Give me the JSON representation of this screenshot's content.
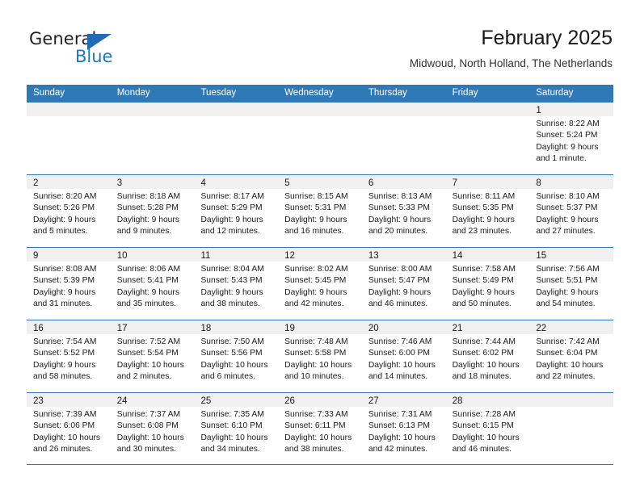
{
  "brand": {
    "name_part1": "General",
    "name_part2": "Blue",
    "logo_icon": "triangle-logo-icon",
    "accent_color": "#1f78c1"
  },
  "header": {
    "title": "February 2025",
    "subtitle": "Midwoud, North Holland, The Netherlands"
  },
  "calendar": {
    "header_color": "#3079b8",
    "weekdays": [
      "Sunday",
      "Monday",
      "Tuesday",
      "Wednesday",
      "Thursday",
      "Friday",
      "Saturday"
    ],
    "weeks": [
      [
        {
          "day": "",
          "sunrise": "",
          "sunset": "",
          "daylight1": "",
          "daylight2": ""
        },
        {
          "day": "",
          "sunrise": "",
          "sunset": "",
          "daylight1": "",
          "daylight2": ""
        },
        {
          "day": "",
          "sunrise": "",
          "sunset": "",
          "daylight1": "",
          "daylight2": ""
        },
        {
          "day": "",
          "sunrise": "",
          "sunset": "",
          "daylight1": "",
          "daylight2": ""
        },
        {
          "day": "",
          "sunrise": "",
          "sunset": "",
          "daylight1": "",
          "daylight2": ""
        },
        {
          "day": "",
          "sunrise": "",
          "sunset": "",
          "daylight1": "",
          "daylight2": ""
        },
        {
          "day": "1",
          "sunrise": "Sunrise: 8:22 AM",
          "sunset": "Sunset: 5:24 PM",
          "daylight1": "Daylight: 9 hours",
          "daylight2": "and 1 minute."
        }
      ],
      [
        {
          "day": "2",
          "sunrise": "Sunrise: 8:20 AM",
          "sunset": "Sunset: 5:26 PM",
          "daylight1": "Daylight: 9 hours",
          "daylight2": "and 5 minutes."
        },
        {
          "day": "3",
          "sunrise": "Sunrise: 8:18 AM",
          "sunset": "Sunset: 5:28 PM",
          "daylight1": "Daylight: 9 hours",
          "daylight2": "and 9 minutes."
        },
        {
          "day": "4",
          "sunrise": "Sunrise: 8:17 AM",
          "sunset": "Sunset: 5:29 PM",
          "daylight1": "Daylight: 9 hours",
          "daylight2": "and 12 minutes."
        },
        {
          "day": "5",
          "sunrise": "Sunrise: 8:15 AM",
          "sunset": "Sunset: 5:31 PM",
          "daylight1": "Daylight: 9 hours",
          "daylight2": "and 16 minutes."
        },
        {
          "day": "6",
          "sunrise": "Sunrise: 8:13 AM",
          "sunset": "Sunset: 5:33 PM",
          "daylight1": "Daylight: 9 hours",
          "daylight2": "and 20 minutes."
        },
        {
          "day": "7",
          "sunrise": "Sunrise: 8:11 AM",
          "sunset": "Sunset: 5:35 PM",
          "daylight1": "Daylight: 9 hours",
          "daylight2": "and 23 minutes."
        },
        {
          "day": "8",
          "sunrise": "Sunrise: 8:10 AM",
          "sunset": "Sunset: 5:37 PM",
          "daylight1": "Daylight: 9 hours",
          "daylight2": "and 27 minutes."
        }
      ],
      [
        {
          "day": "9",
          "sunrise": "Sunrise: 8:08 AM",
          "sunset": "Sunset: 5:39 PM",
          "daylight1": "Daylight: 9 hours",
          "daylight2": "and 31 minutes."
        },
        {
          "day": "10",
          "sunrise": "Sunrise: 8:06 AM",
          "sunset": "Sunset: 5:41 PM",
          "daylight1": "Daylight: 9 hours",
          "daylight2": "and 35 minutes."
        },
        {
          "day": "11",
          "sunrise": "Sunrise: 8:04 AM",
          "sunset": "Sunset: 5:43 PM",
          "daylight1": "Daylight: 9 hours",
          "daylight2": "and 38 minutes."
        },
        {
          "day": "12",
          "sunrise": "Sunrise: 8:02 AM",
          "sunset": "Sunset: 5:45 PM",
          "daylight1": "Daylight: 9 hours",
          "daylight2": "and 42 minutes."
        },
        {
          "day": "13",
          "sunrise": "Sunrise: 8:00 AM",
          "sunset": "Sunset: 5:47 PM",
          "daylight1": "Daylight: 9 hours",
          "daylight2": "and 46 minutes."
        },
        {
          "day": "14",
          "sunrise": "Sunrise: 7:58 AM",
          "sunset": "Sunset: 5:49 PM",
          "daylight1": "Daylight: 9 hours",
          "daylight2": "and 50 minutes."
        },
        {
          "day": "15",
          "sunrise": "Sunrise: 7:56 AM",
          "sunset": "Sunset: 5:51 PM",
          "daylight1": "Daylight: 9 hours",
          "daylight2": "and 54 minutes."
        }
      ],
      [
        {
          "day": "16",
          "sunrise": "Sunrise: 7:54 AM",
          "sunset": "Sunset: 5:52 PM",
          "daylight1": "Daylight: 9 hours",
          "daylight2": "and 58 minutes."
        },
        {
          "day": "17",
          "sunrise": "Sunrise: 7:52 AM",
          "sunset": "Sunset: 5:54 PM",
          "daylight1": "Daylight: 10 hours",
          "daylight2": "and 2 minutes."
        },
        {
          "day": "18",
          "sunrise": "Sunrise: 7:50 AM",
          "sunset": "Sunset: 5:56 PM",
          "daylight1": "Daylight: 10 hours",
          "daylight2": "and 6 minutes."
        },
        {
          "day": "19",
          "sunrise": "Sunrise: 7:48 AM",
          "sunset": "Sunset: 5:58 PM",
          "daylight1": "Daylight: 10 hours",
          "daylight2": "and 10 minutes."
        },
        {
          "day": "20",
          "sunrise": "Sunrise: 7:46 AM",
          "sunset": "Sunset: 6:00 PM",
          "daylight1": "Daylight: 10 hours",
          "daylight2": "and 14 minutes."
        },
        {
          "day": "21",
          "sunrise": "Sunrise: 7:44 AM",
          "sunset": "Sunset: 6:02 PM",
          "daylight1": "Daylight: 10 hours",
          "daylight2": "and 18 minutes."
        },
        {
          "day": "22",
          "sunrise": "Sunrise: 7:42 AM",
          "sunset": "Sunset: 6:04 PM",
          "daylight1": "Daylight: 10 hours",
          "daylight2": "and 22 minutes."
        }
      ],
      [
        {
          "day": "23",
          "sunrise": "Sunrise: 7:39 AM",
          "sunset": "Sunset: 6:06 PM",
          "daylight1": "Daylight: 10 hours",
          "daylight2": "and 26 minutes."
        },
        {
          "day": "24",
          "sunrise": "Sunrise: 7:37 AM",
          "sunset": "Sunset: 6:08 PM",
          "daylight1": "Daylight: 10 hours",
          "daylight2": "and 30 minutes."
        },
        {
          "day": "25",
          "sunrise": "Sunrise: 7:35 AM",
          "sunset": "Sunset: 6:10 PM",
          "daylight1": "Daylight: 10 hours",
          "daylight2": "and 34 minutes."
        },
        {
          "day": "26",
          "sunrise": "Sunrise: 7:33 AM",
          "sunset": "Sunset: 6:11 PM",
          "daylight1": "Daylight: 10 hours",
          "daylight2": "and 38 minutes."
        },
        {
          "day": "27",
          "sunrise": "Sunrise: 7:31 AM",
          "sunset": "Sunset: 6:13 PM",
          "daylight1": "Daylight: 10 hours",
          "daylight2": "and 42 minutes."
        },
        {
          "day": "28",
          "sunrise": "Sunrise: 7:28 AM",
          "sunset": "Sunset: 6:15 PM",
          "daylight1": "Daylight: 10 hours",
          "daylight2": "and 46 minutes."
        },
        {
          "day": "",
          "sunrise": "",
          "sunset": "",
          "daylight1": "",
          "daylight2": ""
        }
      ]
    ]
  }
}
